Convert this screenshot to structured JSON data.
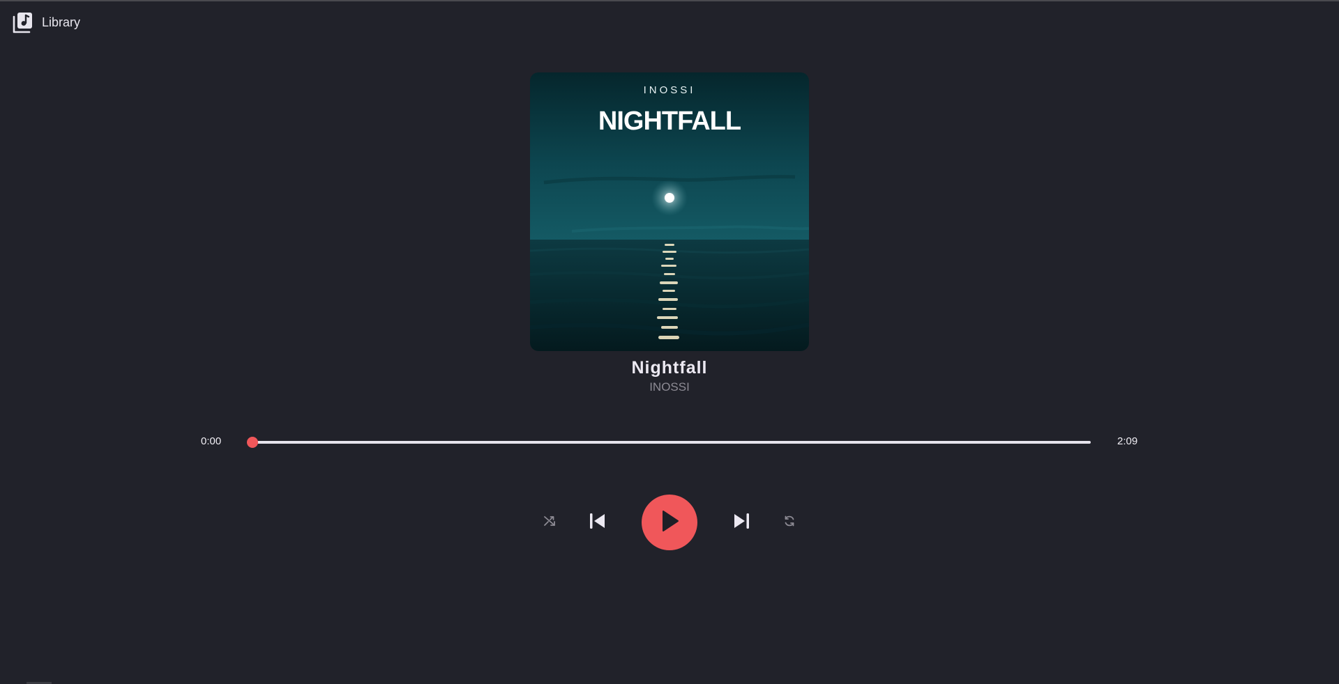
{
  "header": {
    "library_label": "Library",
    "library_icon": "music-library-icon"
  },
  "album_art": {
    "artist_text": "INOSSI",
    "title_text": "NIGHTFALL"
  },
  "track": {
    "title": "Nightfall",
    "artist": "INOSSI"
  },
  "playback": {
    "current_time": "0:00",
    "total_time": "2:09",
    "progress_fraction": 0
  },
  "controls": {
    "shuffle_icon": "shuffle-icon",
    "prev_icon": "skip-previous-icon",
    "play_icon": "play-icon",
    "next_icon": "skip-next-icon",
    "repeat_icon": "repeat-icon"
  },
  "colors": {
    "background": "#21222a",
    "accent": "#f0575a",
    "track": "#e6e3ec",
    "text": "#e8e6ee",
    "muted": "#8d8b94"
  }
}
